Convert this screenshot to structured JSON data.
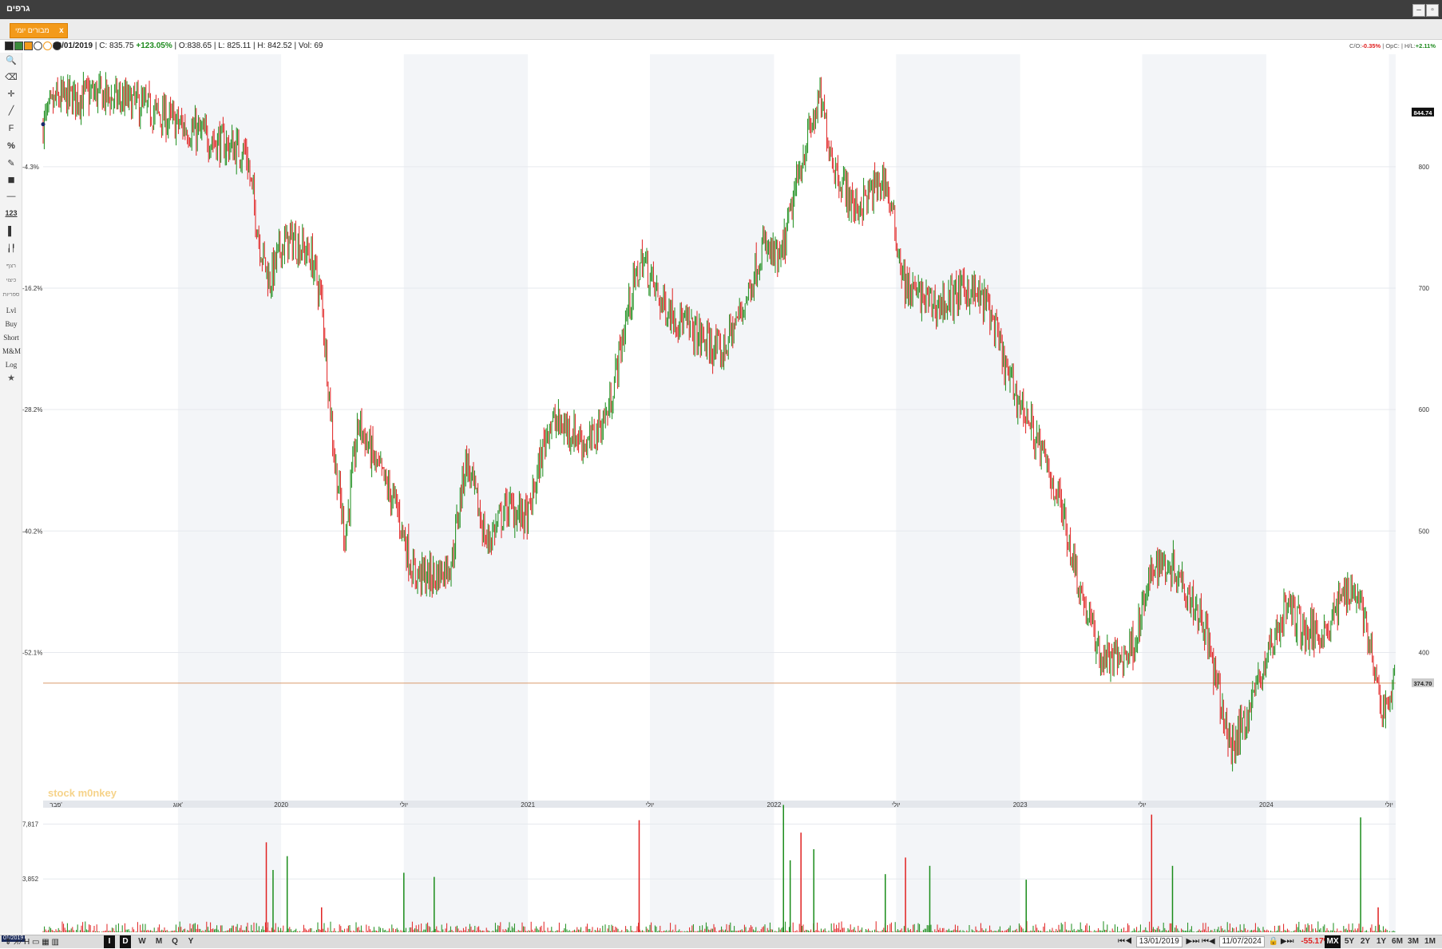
{
  "window": {
    "title": "גרפים",
    "minimize_label": "–",
    "restore_label": "▫"
  },
  "tab": {
    "label": "מבורים יומי",
    "close_label": "x"
  },
  "info": {
    "date": "13/01/2019",
    "close_label": "C:",
    "close_value": "835.75",
    "change": "+123.05%",
    "open_label": "O:",
    "open_value": "838.65",
    "low_label": "L:",
    "low_value": "825.11",
    "high_label": "H:",
    "high_value": "842.52",
    "vol_label": "Vol:",
    "vol_value": "69",
    "co_label": "C/O:",
    "co_value": "-0.35%",
    "opc_label": "OpC:",
    "hl_label": "H/L:",
    "hl_value": "+2.11%"
  },
  "toolbar": {
    "items": [
      {
        "name": "zoom-icon",
        "glyph": "🔍"
      },
      {
        "name": "eraser-icon",
        "glyph": "⌫"
      },
      {
        "name": "crosshair-icon",
        "glyph": "✛"
      },
      {
        "name": "pencil-icon",
        "glyph": "╱"
      },
      {
        "name": "fib-icon",
        "glyph": "F"
      },
      {
        "name": "percent-icon",
        "glyph": "%"
      },
      {
        "name": "edit-icon",
        "glyph": "✎"
      },
      {
        "name": "color-icon",
        "glyph": "■"
      },
      {
        "name": "line-icon",
        "glyph": "—"
      },
      {
        "name": "numbers-icon",
        "glyph": "123"
      },
      {
        "name": "bar-icon",
        "glyph": "▌"
      },
      {
        "name": "candles-icon",
        "glyph": "╽╿"
      }
    ],
    "small_items": [
      "רצף",
      "כיצוי",
      "ספריות"
    ],
    "text_items": [
      "Lvl",
      "Buy",
      "Short",
      "M&M",
      "Log"
    ],
    "star_glyph": "★"
  },
  "chart_data": {
    "type": "candlestick",
    "title": "",
    "x_start": "2019-01-13",
    "x_end": "2024-07-11",
    "ylim": [
      280,
      890
    ],
    "y_ticks": [
      400,
      500,
      600,
      700,
      800
    ],
    "y_tick_labels": [
      "400",
      "500",
      "600",
      "700",
      "800"
    ],
    "pct_ticks": [
      {
        "price": 800,
        "label": "-4.3%"
      },
      {
        "price": 700,
        "label": "-16.2%"
      },
      {
        "price": 600,
        "label": "-28.2%"
      },
      {
        "price": 500,
        "label": "-40.2%"
      },
      {
        "price": 400,
        "label": "-52.1%"
      }
    ],
    "price_labels": {
      "high_marker": "844.74",
      "last": "374.70"
    },
    "last_price": 374.7,
    "high_price": 844.74,
    "x_labels": [
      {
        "date": "2019-02-01",
        "label": "פבר'"
      },
      {
        "date": "2019-08-01",
        "label": "אוג'"
      },
      {
        "date": "2020-01-01",
        "label": "2020"
      },
      {
        "date": "2020-07-01",
        "label": "יולי"
      },
      {
        "date": "2021-01-01",
        "label": "2021"
      },
      {
        "date": "2021-07-01",
        "label": "יולי"
      },
      {
        "date": "2022-01-01",
        "label": "2022"
      },
      {
        "date": "2022-07-01",
        "label": "יולי"
      },
      {
        "date": "2023-01-01",
        "label": "2023"
      },
      {
        "date": "2023-07-01",
        "label": "יולי"
      },
      {
        "date": "2024-01-01",
        "label": "2024"
      },
      {
        "date": "2024-07-01",
        "label": "יולי"
      }
    ],
    "bands": [
      [
        "2019-08-01",
        "2020-01-01"
      ],
      [
        "2020-07-01",
        "2021-01-01"
      ],
      [
        "2021-07-01",
        "2022-01-01"
      ],
      [
        "2022-07-01",
        "2023-01-01"
      ],
      [
        "2023-07-01",
        "2024-01-01"
      ],
      [
        "2024-07-01",
        "2024-07-11"
      ]
    ],
    "close_path": [
      [
        "2019-01-13",
        835
      ],
      [
        "2019-02-01",
        855
      ],
      [
        "2019-04-01",
        860
      ],
      [
        "2019-06-01",
        852
      ],
      [
        "2019-08-01",
        835
      ],
      [
        "2019-10-01",
        820
      ],
      [
        "2019-11-10",
        812
      ],
      [
        "2019-12-01",
        735
      ],
      [
        "2019-12-15",
        705
      ],
      [
        "2020-01-01",
        735
      ],
      [
        "2020-01-20",
        740
      ],
      [
        "2020-02-15",
        725
      ],
      [
        "2020-03-01",
        690
      ],
      [
        "2020-03-20",
        560
      ],
      [
        "2020-04-05",
        495
      ],
      [
        "2020-04-25",
        590
      ],
      [
        "2020-05-20",
        555
      ],
      [
        "2020-06-20",
        520
      ],
      [
        "2020-07-15",
        465
      ],
      [
        "2020-08-15",
        462
      ],
      [
        "2020-09-10",
        475
      ],
      [
        "2020-10-01",
        560
      ],
      [
        "2020-11-01",
        490
      ],
      [
        "2020-12-01",
        520
      ],
      [
        "2021-01-01",
        510
      ],
      [
        "2021-02-01",
        590
      ],
      [
        "2021-03-01",
        585
      ],
      [
        "2021-04-01",
        570
      ],
      [
        "2021-05-01",
        600
      ],
      [
        "2021-06-01",
        690
      ],
      [
        "2021-06-20",
        725
      ],
      [
        "2021-07-15",
        690
      ],
      [
        "2021-09-01",
        665
      ],
      [
        "2021-10-15",
        645
      ],
      [
        "2021-11-20",
        690
      ],
      [
        "2021-12-15",
        735
      ],
      [
        "2022-01-10",
        720
      ],
      [
        "2022-02-15",
        815
      ],
      [
        "2022-03-10",
        855
      ],
      [
        "2022-04-01",
        800
      ],
      [
        "2022-05-01",
        765
      ],
      [
        "2022-06-15",
        790
      ],
      [
        "2022-07-15",
        700
      ],
      [
        "2022-09-01",
        685
      ],
      [
        "2022-10-15",
        700
      ],
      [
        "2022-11-15",
        685
      ],
      [
        "2022-12-15",
        625
      ],
      [
        "2023-01-15",
        590
      ],
      [
        "2023-02-15",
        545
      ],
      [
        "2023-03-01",
        525
      ],
      [
        "2023-04-01",
        450
      ],
      [
        "2023-05-01",
        395
      ],
      [
        "2023-06-01",
        395
      ],
      [
        "2023-06-20",
        410
      ],
      [
        "2023-07-20",
        475
      ],
      [
        "2023-08-20",
        470
      ],
      [
        "2023-10-01",
        425
      ],
      [
        "2023-10-20",
        370
      ],
      [
        "2023-11-10",
        320
      ],
      [
        "2023-12-01",
        345
      ],
      [
        "2024-01-01",
        395
      ],
      [
        "2024-02-01",
        440
      ],
      [
        "2024-03-01",
        415
      ],
      [
        "2024-04-01",
        420
      ],
      [
        "2024-05-01",
        455
      ],
      [
        "2024-05-20",
        445
      ],
      [
        "2024-06-20",
        350
      ],
      [
        "2024-07-11",
        375
      ]
    ],
    "volume": {
      "ticks": [
        {
          "value": 3852,
          "label": "3,852"
        },
        {
          "value": 7817,
          "label": "7,817"
        }
      ],
      "max": 9000,
      "spikes": [
        [
          "2019-12-10",
          6500
        ],
        [
          "2019-12-20",
          4500
        ],
        [
          "2020-01-10",
          5500
        ],
        [
          "2020-03-01",
          1800
        ],
        [
          "2020-07-01",
          4300
        ],
        [
          "2020-08-15",
          4000
        ],
        [
          "2021-06-15",
          8100
        ],
        [
          "2022-01-15",
          9200
        ],
        [
          "2022-01-25",
          5200
        ],
        [
          "2022-02-10",
          7200
        ],
        [
          "2022-03-01",
          6000
        ],
        [
          "2022-06-15",
          4200
        ],
        [
          "2022-07-15",
          5400
        ],
        [
          "2022-08-20",
          4800
        ],
        [
          "2023-01-10",
          3800
        ],
        [
          "2023-07-15",
          8500
        ],
        [
          "2023-08-15",
          4800
        ],
        [
          "2024-05-20",
          8300
        ],
        [
          "2024-06-15",
          1800
        ]
      ]
    }
  },
  "watermark": "stock m0nkey",
  "bottom": {
    "periods": [
      {
        "label": "I",
        "selected": true
      },
      {
        "label": "D",
        "selected": true
      },
      {
        "label": "W",
        "selected": false
      },
      {
        "label": "M",
        "selected": false
      },
      {
        "label": "Q",
        "selected": false
      },
      {
        "label": "Y",
        "selected": false
      }
    ],
    "start_date": "13/01/2019",
    "end_date": "11/07/2024",
    "range_change": "-55.17%",
    "ranges": [
      {
        "label": "MX",
        "selected": true
      },
      {
        "label": "5Y",
        "selected": false
      },
      {
        "label": "2Y",
        "selected": false
      },
      {
        "label": "1Y",
        "selected": false
      },
      {
        "label": "6M",
        "selected": false
      },
      {
        "label": "3M",
        "selected": false
      },
      {
        "label": "1M",
        "selected": false
      }
    ],
    "first_date_label": "01/2019"
  },
  "colors": {
    "up": "#1a8c1a",
    "down": "#e02020",
    "band": "#f3f5f8",
    "grid": "#e6e9ee",
    "last_line": "#d99a6c"
  }
}
